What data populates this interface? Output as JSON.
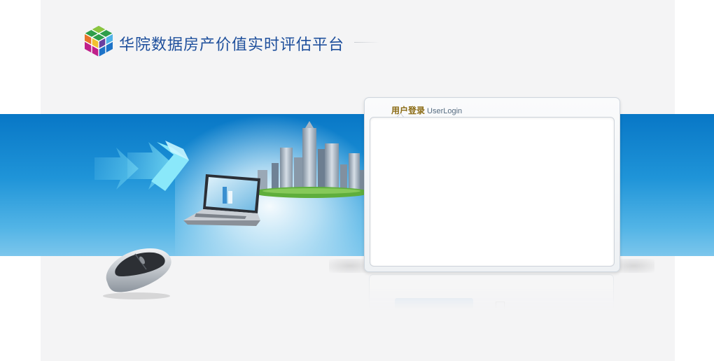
{
  "header": {
    "site_title": "华院数据房产价值实时评估平台",
    "logo_icon": "cube-logo-icon"
  },
  "login": {
    "title_cn": "用户登录",
    "title_en": "UserLogin"
  },
  "decor": {
    "arrows_icon": "arrows-icon",
    "laptop_icon": "laptop-icon",
    "city_icon": "city-skyline-icon",
    "mouse_icon": "computer-mouse-icon"
  },
  "colors": {
    "banner_blue": "#0877c6",
    "title_blue": "#1e4f9c",
    "login_title_gold": "#8a6a12"
  }
}
